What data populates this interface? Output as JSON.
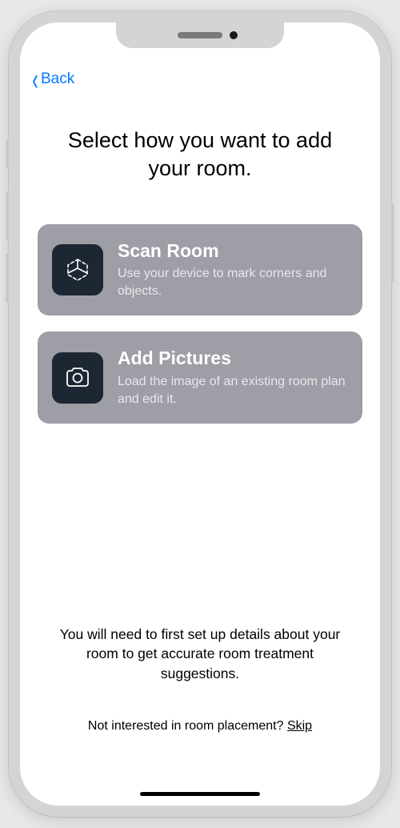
{
  "nav": {
    "back_label": "Back"
  },
  "title": "Select how you want to add your room.",
  "options": [
    {
      "title": "Scan Room",
      "subtitle": "Use your device to mark corners and objects.",
      "icon": "scan"
    },
    {
      "title": "Add Pictures",
      "subtitle": "Load the image of an existing room plan and edit it.",
      "icon": "camera"
    }
  ],
  "info_text": "You will need to first set up details about your room to get accurate room treatment suggestions.",
  "skip_prefix": "Not interested in room placement? ",
  "skip_label": "Skip"
}
